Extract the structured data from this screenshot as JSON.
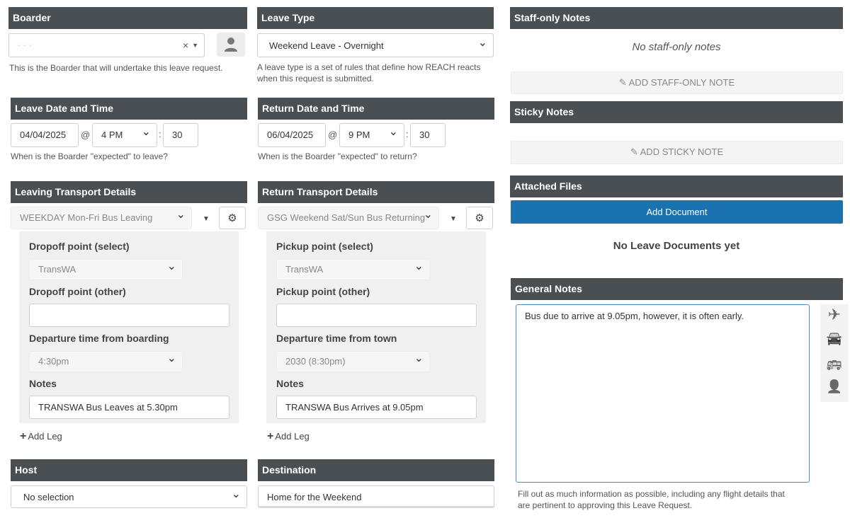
{
  "boarder": {
    "title": "Boarder",
    "selected": "· · ·",
    "clear_icon": "×",
    "help": "This is the Boarder that will undertake this leave request."
  },
  "leave_type": {
    "title": "Leave Type",
    "selected": "Weekend Leave - Overnight",
    "help_line1": "A leave type is a set of rules that define how REACH reacts",
    "help_line2": "when this request is submitted."
  },
  "leave_dt": {
    "title": "Leave Date and Time",
    "date": "04/04/2025",
    "at": "@",
    "hour": "4 PM",
    "colon": ":",
    "minute": "30",
    "help": "When is the Boarder \"expected\" to leave?"
  },
  "return_dt": {
    "title": "Return Date and Time",
    "date": "06/04/2025",
    "at": "@",
    "hour": "9 PM",
    "colon": ":",
    "minute": "30",
    "help": "When is the Boarder \"expected\" to return?"
  },
  "leaving_transport": {
    "title": "Leaving Transport Details",
    "option": "WEEKDAY Mon-Fri Bus Leaving",
    "point_select_label": "Dropoff point (select)",
    "point_select_value": "TransWA",
    "point_other_label": "Dropoff point (other)",
    "point_other_value": "",
    "time_label": "Departure time from boarding",
    "time_value": "4:30pm",
    "notes_label": "Notes",
    "notes_value": "TRANSWA Bus Leaves at 5.30pm",
    "add_leg": "Add Leg"
  },
  "return_transport": {
    "title": "Return Transport Details",
    "option": "GSG Weekend Sat/Sun Bus Returning",
    "point_select_label": "Pickup point (select)",
    "point_select_value": "TransWA",
    "point_other_label": "Pickup point (other)",
    "point_other_value": "",
    "time_label": "Departure time from town",
    "time_value": "2030 (8:30pm)",
    "notes_label": "Notes",
    "notes_value": "TRANSWA Bus Arrives at 9.05pm",
    "add_leg": "Add Leg"
  },
  "host": {
    "title": "Host",
    "selected": "No selection"
  },
  "destination": {
    "title": "Destination",
    "value": "Home for the Weekend"
  },
  "staff_notes": {
    "title": "Staff-only Notes",
    "empty": "No staff-only notes",
    "add_button": "ADD STAFF-ONLY NOTE"
  },
  "sticky_notes": {
    "title": "Sticky Notes",
    "add_button": "ADD STICKY NOTE"
  },
  "attached_files": {
    "title": "Attached Files",
    "add_button": "Add Document",
    "empty": "No Leave Documents yet"
  },
  "general_notes": {
    "title": "General Notes",
    "value": "Bus due to arrive at 9.05pm, however, it is often early.",
    "help_line1": "Fill out as much information as possible, including any flight details that",
    "help_line2": "are pertinent to approving this Leave Request."
  },
  "icons": {
    "chevron": "⌄",
    "caret": "▼",
    "gear": "⚙",
    "plus": "+",
    "edit": "✎",
    "plane": "✈",
    "car": "🚘",
    "bus": "🚌",
    "person": "👤"
  },
  "colors": {
    "header_bg": "#4a4f53",
    "primary": "#1a73b0"
  }
}
